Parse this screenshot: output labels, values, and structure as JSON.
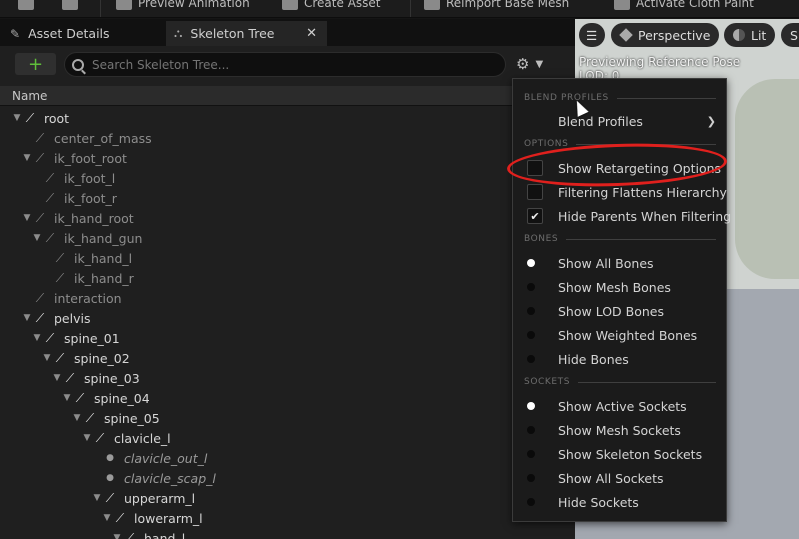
{
  "toolbar": {
    "items": [
      {
        "label": "",
        "icon": "save-icon"
      },
      {
        "label": "",
        "icon": "browse-icon"
      },
      {
        "label": "Preview Animation",
        "icon": "play-icon"
      },
      {
        "label": "Create Asset",
        "icon": "add-icon"
      },
      {
        "label": "Reimport Base Mesh",
        "icon": "reimport-icon"
      },
      {
        "label": "Activate Cloth Paint",
        "icon": "cloth-icon"
      }
    ]
  },
  "tabs": [
    {
      "label": "Asset Details",
      "icon": "details-icon"
    },
    {
      "label": "Skeleton Tree",
      "icon": "skeleton-tree-icon",
      "active": true
    }
  ],
  "panel": {
    "add_label": "+",
    "search_placeholder": "Search Skeleton Tree...",
    "column_name": "Name"
  },
  "tree": [
    {
      "label": "root",
      "depth": 0,
      "expanded": true,
      "style": "bone"
    },
    {
      "label": "center_of_mass",
      "depth": 1,
      "style": "dim"
    },
    {
      "label": "ik_foot_root",
      "depth": 1,
      "expanded": true,
      "style": "dim"
    },
    {
      "label": "ik_foot_l",
      "depth": 2,
      "style": "dim"
    },
    {
      "label": "ik_foot_r",
      "depth": 2,
      "style": "dim"
    },
    {
      "label": "ik_hand_root",
      "depth": 1,
      "expanded": true,
      "style": "dim"
    },
    {
      "label": "ik_hand_gun",
      "depth": 2,
      "expanded": true,
      "style": "dim"
    },
    {
      "label": "ik_hand_l",
      "depth": 3,
      "style": "dim"
    },
    {
      "label": "ik_hand_r",
      "depth": 3,
      "style": "dim"
    },
    {
      "label": "interaction",
      "depth": 1,
      "style": "dim"
    },
    {
      "label": "pelvis",
      "depth": 1,
      "expanded": true,
      "style": "bone"
    },
    {
      "label": "spine_01",
      "depth": 2,
      "expanded": true,
      "style": "bone"
    },
    {
      "label": "spine_02",
      "depth": 3,
      "expanded": true,
      "style": "bone"
    },
    {
      "label": "spine_03",
      "depth": 4,
      "expanded": true,
      "style": "bone"
    },
    {
      "label": "spine_04",
      "depth": 5,
      "expanded": true,
      "style": "bone"
    },
    {
      "label": "spine_05",
      "depth": 6,
      "expanded": true,
      "style": "bone"
    },
    {
      "label": "clavicle_l",
      "depth": 7,
      "expanded": true,
      "style": "bone"
    },
    {
      "label": "clavicle_out_l",
      "depth": 8,
      "style": "socket"
    },
    {
      "label": "clavicle_scap_l",
      "depth": 8,
      "style": "socket"
    },
    {
      "label": "upperarm_l",
      "depth": 8,
      "expanded": true,
      "style": "bone"
    },
    {
      "label": "lowerarm_l",
      "depth": 9,
      "expanded": true,
      "style": "bone"
    },
    {
      "label": "hand_l",
      "depth": 10,
      "expanded": true,
      "style": "bone"
    }
  ],
  "viewport": {
    "menu_icon": "hamburger-icon",
    "perspective_label": "Perspective",
    "lit_label": "Lit",
    "show_label": "Sh",
    "overlay_line1": "Previewing Reference Pose",
    "overlay_line2": "LOD: 0"
  },
  "menu": {
    "sections": {
      "blend_profiles": "BLEND PROFILES",
      "options": "OPTIONS",
      "bones": "BONES",
      "sockets": "SOCKETS"
    },
    "blend_profiles_label": "Blend Profiles",
    "options": [
      {
        "label": "Show Retargeting Options",
        "checked": false
      },
      {
        "label": "Filtering Flattens Hierarchy",
        "checked": false
      },
      {
        "label": "Hide Parents When Filtering",
        "checked": true
      }
    ],
    "bones": [
      {
        "label": "Show All Bones",
        "selected": true
      },
      {
        "label": "Show Mesh Bones",
        "selected": false
      },
      {
        "label": "Show LOD Bones",
        "selected": false
      },
      {
        "label": "Show Weighted Bones",
        "selected": false
      },
      {
        "label": "Hide Bones",
        "selected": false
      }
    ],
    "sockets": [
      {
        "label": "Show Active Sockets",
        "selected": true
      },
      {
        "label": "Show Mesh Sockets",
        "selected": false
      },
      {
        "label": "Show Skeleton Sockets",
        "selected": false
      },
      {
        "label": "Show All Sockets",
        "selected": false
      },
      {
        "label": "Hide Sockets",
        "selected": false
      }
    ]
  },
  "colors": {
    "highlight": "#e0201d",
    "add_accent": "#5fbf3a"
  }
}
